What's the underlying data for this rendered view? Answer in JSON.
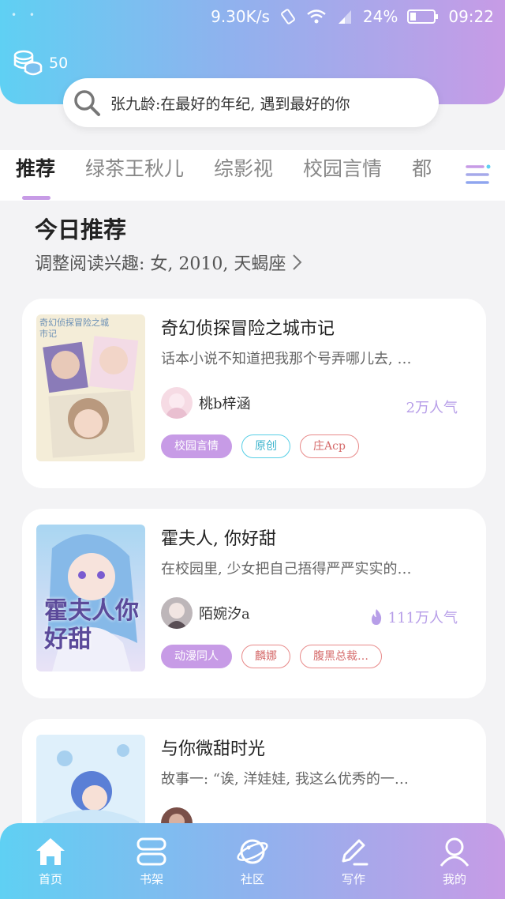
{
  "status": {
    "speed": "9.30K/s",
    "battery": "24%",
    "time": "09:22"
  },
  "coins": {
    "count": "50"
  },
  "search": {
    "query": "张九龄:在最好的年纪, 遇到最好的你"
  },
  "tabs": [
    {
      "label": "推荐"
    },
    {
      "label": "绿茶王秋儿"
    },
    {
      "label": "综影视"
    },
    {
      "label": "校园言情"
    },
    {
      "label": "都"
    }
  ],
  "section": {
    "title": "今日推荐",
    "subtitle": "调整阅读兴趣: 女, 2010, 天蝎座"
  },
  "cards": [
    {
      "title": "奇幻侦探冒险之城市记",
      "desc": "话本小说不知道把我那个号弄哪儿去, …",
      "author": "桃b梓涵",
      "popularity": "2万人气",
      "cover_text": "奇幻侦探冒险之城市记",
      "tags": [
        "校园言情",
        "原创",
        "庄Acp"
      ]
    },
    {
      "title": "霍夫人, 你好甜",
      "desc": "在校园里, 少女把自己捂得严严实实的…",
      "author": "陌婉汐a",
      "popularity": "111万人气",
      "cover_text": "霍夫人你好甜",
      "tags": [
        "动漫同人",
        "麟娜",
        "腹黑总裁…"
      ]
    },
    {
      "title": "与你微甜时光",
      "desc": "故事一: “诶, 洋娃娃, 我这么优秀的一…",
      "author": "",
      "popularity": "",
      "cover_text": "",
      "tags": []
    }
  ],
  "nav": [
    {
      "label": "首页",
      "icon": "home-icon"
    },
    {
      "label": "书架",
      "icon": "bookshelf-icon"
    },
    {
      "label": "社区",
      "icon": "community-icon"
    },
    {
      "label": "写作",
      "icon": "write-icon"
    },
    {
      "label": "我的",
      "icon": "profile-icon"
    }
  ],
  "colors": {
    "accent": "#c79be6",
    "gradient_start": "#5fd0f3",
    "gradient_end": "#c79be6"
  }
}
